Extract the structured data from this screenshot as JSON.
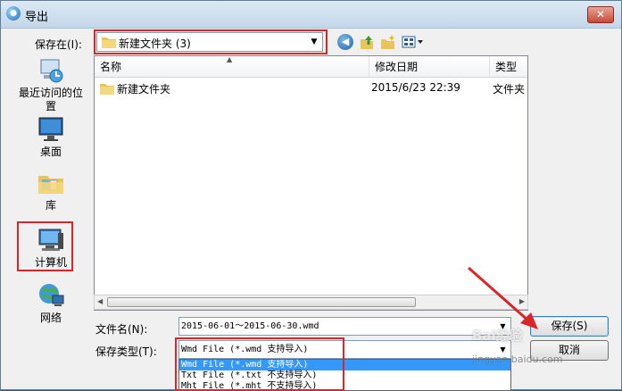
{
  "window": {
    "title": "导出",
    "close_glyph": "✕"
  },
  "toolbar": {
    "save_in_label": "保存在(I):",
    "save_in_value": "新建文件夹 (3)",
    "icons": [
      "back-icon",
      "up-folder-icon",
      "new-folder-icon",
      "views-menu-icon"
    ]
  },
  "places": [
    {
      "label": "最近访问的位置",
      "icon": "recent-places-icon"
    },
    {
      "label": "桌面",
      "icon": "desktop-icon"
    },
    {
      "label": "库",
      "icon": "libraries-icon"
    },
    {
      "label": "计算机",
      "icon": "computer-icon"
    },
    {
      "label": "网络",
      "icon": "network-icon"
    }
  ],
  "file_list": {
    "columns": [
      "名称",
      "修改日期",
      "类型"
    ],
    "rows": [
      {
        "name": "新建文件夹",
        "date": "2015/6/23 22:39",
        "type": "文件夹"
      }
    ]
  },
  "form": {
    "filename_label": "文件名(N):",
    "filename_value": "2015-06-01～2015-06-30.wmd",
    "filetype_label": "保存类型(T):",
    "filetype_value": "Wmd File (*.wmd 支持导入)",
    "filetype_options": [
      "Wmd File (*.wmd 支持导入)",
      "Txt File (*.txt 不支持导入)",
      "Mht File (*.mht 不支持导入)"
    ],
    "selected_option_index": 0
  },
  "buttons": {
    "save": "保存(S)",
    "cancel": "取消"
  },
  "watermark": {
    "text": "Bai经验",
    "sub": "jingyan.baidu.com"
  },
  "colors": {
    "highlight": "#d8262b",
    "selection": "#3399ff"
  }
}
